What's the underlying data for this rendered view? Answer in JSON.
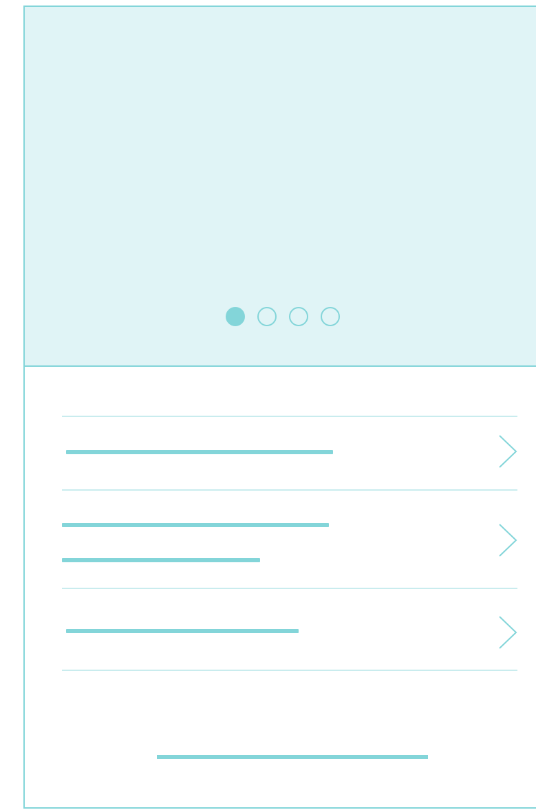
{
  "colors": {
    "accent": "#83d5d9",
    "hero_background": "#e0f4f6",
    "divider": "#c9ecee",
    "background": "#ffffff"
  },
  "carousel": {
    "page_count": 4,
    "active_index": 0
  },
  "list": {
    "items": [
      {
        "text_lines": 1,
        "icon": "chevron-right-icon"
      },
      {
        "text_lines": 2,
        "icon": "chevron-right-icon"
      },
      {
        "text_lines": 1,
        "icon": "chevron-right-icon"
      }
    ]
  },
  "footer": {
    "text_lines": 1
  }
}
